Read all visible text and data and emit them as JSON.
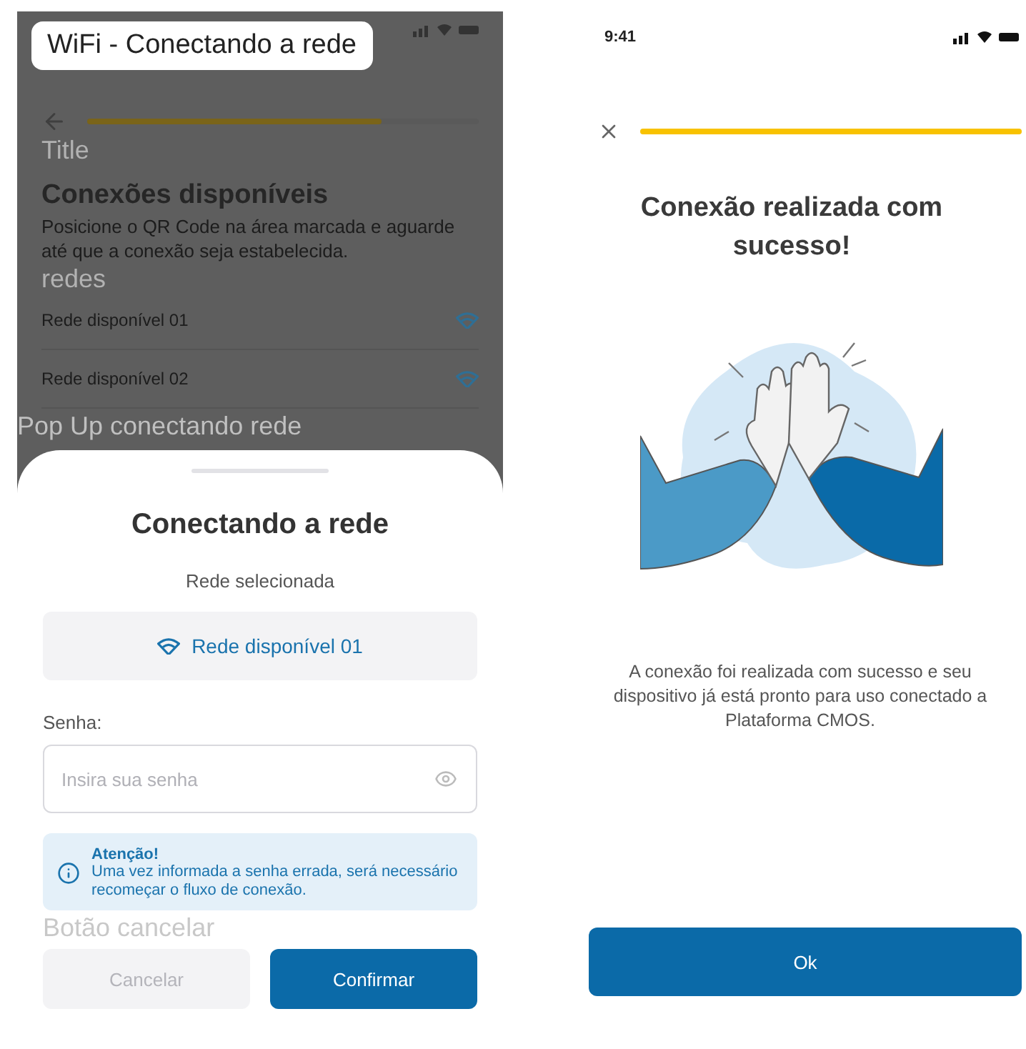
{
  "left_screen": {
    "frame_label": "WiFi - Conectando a rede",
    "annotations": [
      "Title",
      "redes",
      "Pop Up conectando rede",
      "Botão cancelar"
    ],
    "progress": {
      "level": 0.75
    },
    "heading": "Conexões disponíveis",
    "description": "Posicione o QR Code na área marcada e aguarde até que a conexão seja estabelecida.",
    "networks": [
      {
        "name": "Rede disponível 01"
      },
      {
        "name": "Rede disponível 02"
      }
    ],
    "sheet": {
      "title": "Conectando a rede",
      "subtitle": "Rede selecionada",
      "selected_network": "Rede disponível 01",
      "password_label": "Senha:",
      "password_placeholder": "Insira sua senha",
      "alert": {
        "title": "Atenção!",
        "text": "Uma vez informada a senha errada, será necessário recomeçar o fluxo de conexão."
      },
      "buttons": [
        {
          "label": "Cancelar",
          "disabled": true
        },
        {
          "label": "Confirmar",
          "disabled": false
        }
      ]
    }
  },
  "right_screen": {
    "status_time": "9:41",
    "progress": {
      "level": 1
    },
    "title": "Conexão realizada com sucesso!",
    "message": "A conexão foi realizada com sucesso e seu dispositivo já está pronto para uso conectado a Plataforma CMOS.",
    "button": "Ok"
  }
}
